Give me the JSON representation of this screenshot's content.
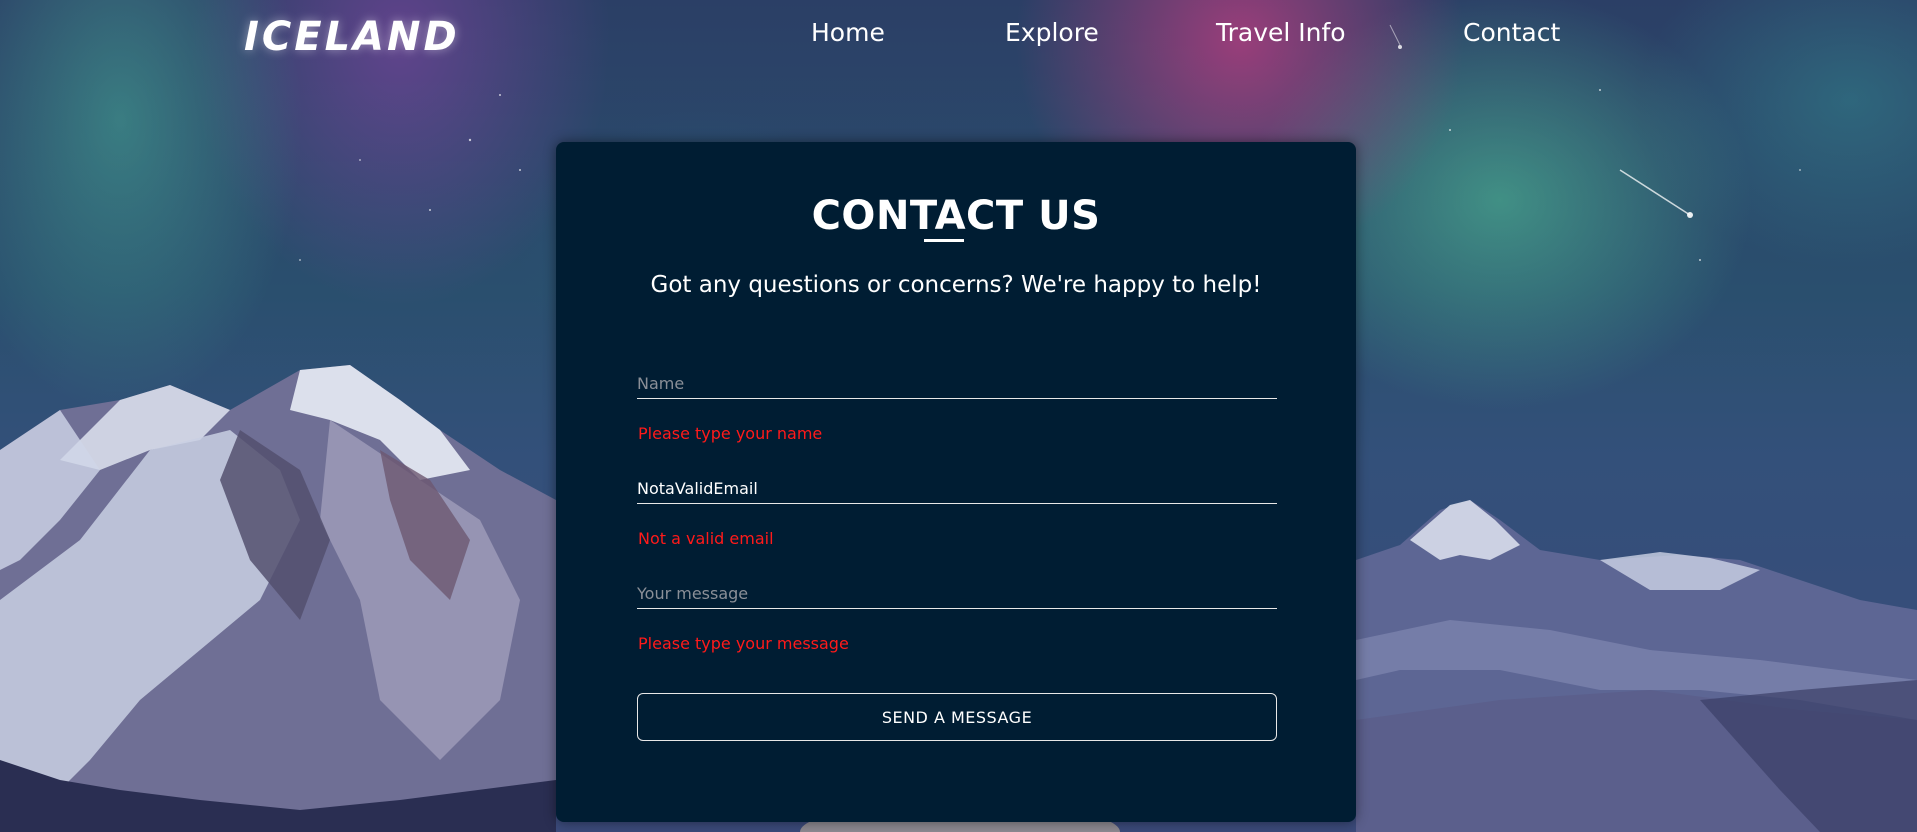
{
  "header": {
    "logo": "ICELAND",
    "nav": [
      "Home",
      "Explore",
      "Travel Info",
      "Contact"
    ]
  },
  "contact": {
    "title": "CONTACT US",
    "subtitle": "Got any questions or concerns? We're happy to help!",
    "name_placeholder": "Name",
    "name_value": "",
    "name_error": "Please type your name",
    "email_value": "NotaValidEmail",
    "email_error": "Not a valid email",
    "message_placeholder": "Your message",
    "message_value": "",
    "message_error": "Please type your message",
    "send_label": "SEND A MESSAGE"
  },
  "colors": {
    "card_bg": "#001d33",
    "error": "#ff1a1a",
    "text": "#ffffff"
  }
}
